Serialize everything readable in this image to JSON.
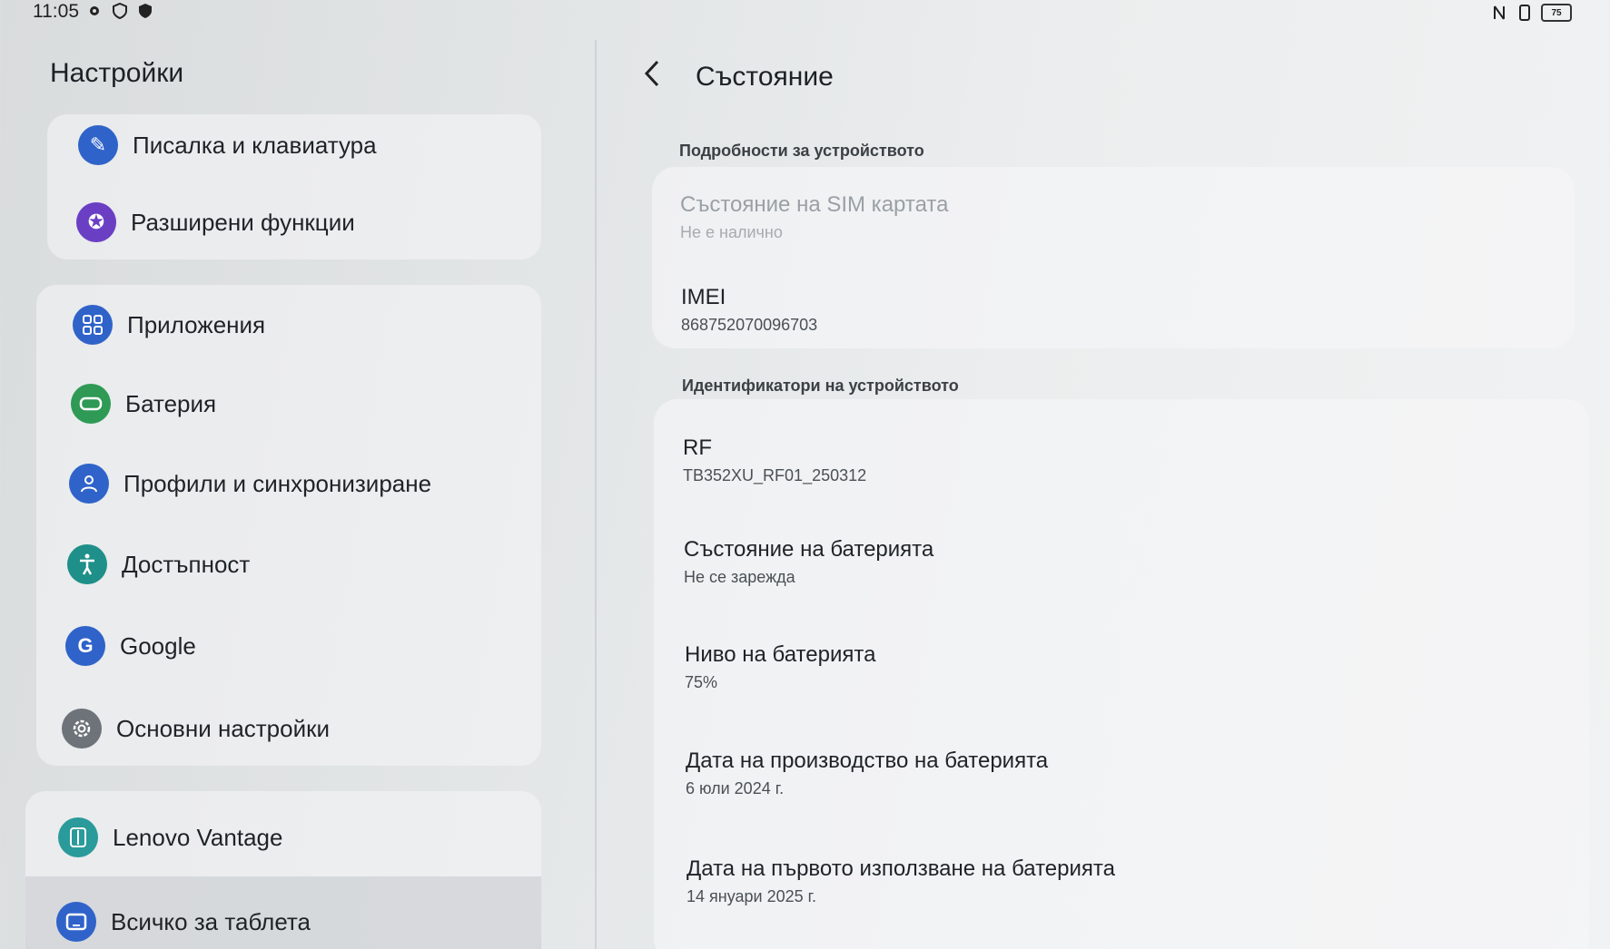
{
  "status_bar": {
    "time": "11:05",
    "left_icons": [
      "gear-icon",
      "shield-icon",
      "security-icon"
    ],
    "battery_level": "75"
  },
  "left_pane": {
    "title": "Настройки",
    "items": [
      {
        "label": "Писалка и клавиатура",
        "icon": "pen-icon",
        "color": "#2f63c9"
      },
      {
        "label": "Разширени функции",
        "icon": "advanced-features-icon",
        "color": "#6a3fc4"
      },
      {
        "label": "Приложения",
        "icon": "apps-grid-icon",
        "color": "#2f63c9"
      },
      {
        "label": "Батерия",
        "icon": "battery-icon",
        "color": "#2e9a55"
      },
      {
        "label": "Профили и синхронизиране",
        "icon": "person-icon",
        "color": "#2f63c9"
      },
      {
        "label": "Достъпност",
        "icon": "accessibility-icon",
        "color": "#1f8f89"
      },
      {
        "label": "Google",
        "icon": "google-icon",
        "color": "#2f63c9"
      },
      {
        "label": "Основни настройки",
        "icon": "gear-icon",
        "color": "#6d7378"
      },
      {
        "label": "Lenovo Vantage",
        "icon": "lenovo-vantage-icon",
        "color": "#2a9a9a"
      },
      {
        "label": "Всичко за таблета",
        "icon": "tablet-icon",
        "color": "#2f63c9"
      }
    ]
  },
  "right_pane": {
    "title": "Състояние",
    "section1_label": "Подробности за устройството",
    "sim_title": "Състояние на SIM картата",
    "sim_value": "Не е налично",
    "imei_title": "IMEI",
    "imei_value": "868752070096703",
    "section2_label": "Идентификатори на устройството",
    "rf_title": "RF",
    "rf_value": "TB352XU_RF01_250312",
    "battery_status_title": "Състояние на батерията",
    "battery_status_value": "Не се зарежда",
    "battery_level_title": "Ниво на батерията",
    "battery_level_value": "75%",
    "battery_mfg_title": "Дата на производство на батерията",
    "battery_mfg_value": "6 юли 2024 г.",
    "battery_first_use_title": "Дата на първото използване на батерията",
    "battery_first_use_value": "14 януари 2025 г."
  }
}
